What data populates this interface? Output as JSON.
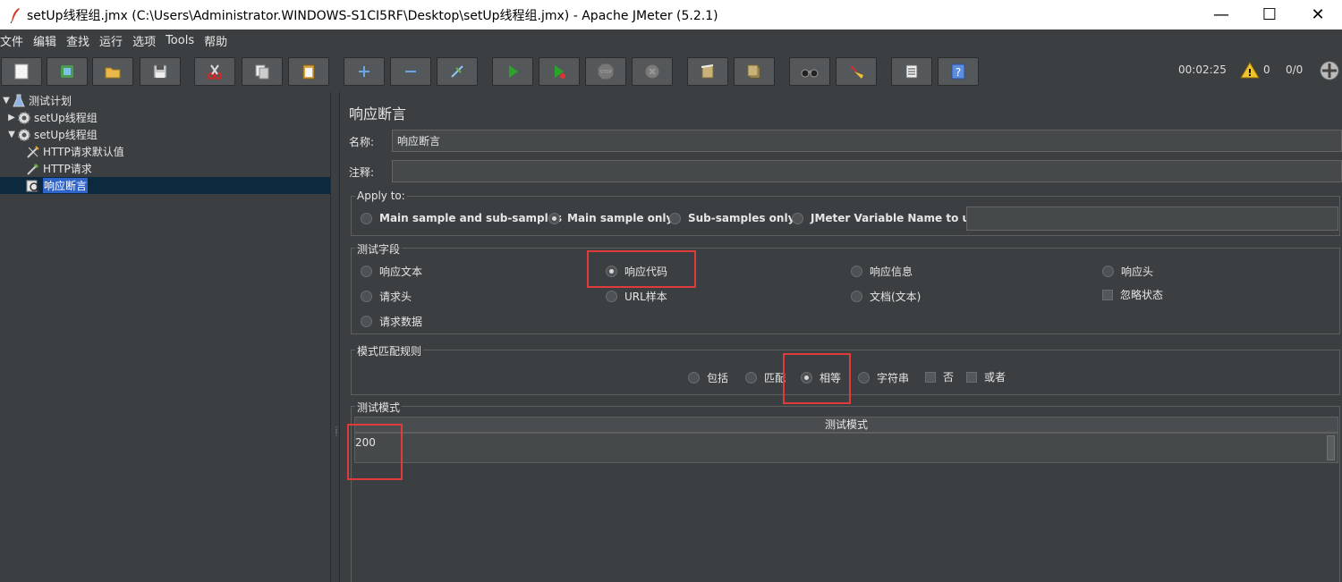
{
  "window": {
    "title": "setUp线程组.jmx (C:\\Users\\Administrator.WINDOWS-S1CI5RF\\Desktop\\setUp线程组.jmx) - Apache JMeter (5.2.1)",
    "minimize": "—",
    "maximize": "☐",
    "close": "✕"
  },
  "menu": [
    "文件",
    "编辑",
    "查找",
    "运行",
    "选项",
    "Tools",
    "帮助"
  ],
  "toolbar": {
    "elapsed": "00:02:25",
    "warnings": "0",
    "threads": "0/0"
  },
  "tree": {
    "root": "测试计划",
    "items": [
      {
        "label": "setUp线程组"
      },
      {
        "label": "setUp线程组"
      },
      {
        "label": "HTTP请求默认值"
      },
      {
        "label": "HTTP请求"
      },
      {
        "label": "响应断言"
      }
    ]
  },
  "panel": {
    "title": "响应断言",
    "name_label": "名称:",
    "name_value": "响应断言",
    "comment_label": "注释:",
    "comment_value": "",
    "apply_to": {
      "title": "Apply to:",
      "options": [
        "Main sample and sub-samples",
        "Main sample only",
        "Sub-samples only",
        "JMeter Variable Name to use"
      ],
      "selected": "Main sample only",
      "variable_value": ""
    },
    "field_to_test": {
      "title": "测试字段",
      "options": [
        "响应文本",
        "响应代码",
        "响应信息",
        "响应头",
        "请求头",
        "URL样本",
        "文档(文本)",
        "请求数据"
      ],
      "selected": "响应代码",
      "ignore_status": "忽略状态"
    },
    "match_rules": {
      "title": "模式匹配规则",
      "options": [
        "包括",
        "匹配",
        "相等",
        "字符串"
      ],
      "selected": "相等",
      "not_label": "否",
      "or_label": "或者"
    },
    "patterns": {
      "title": "测试模式",
      "column": "测试模式",
      "rows": [
        "200"
      ]
    }
  },
  "colors": {
    "background": "#3c3f41",
    "highlight": "#e03a3a",
    "selection": "#2f65ca"
  }
}
